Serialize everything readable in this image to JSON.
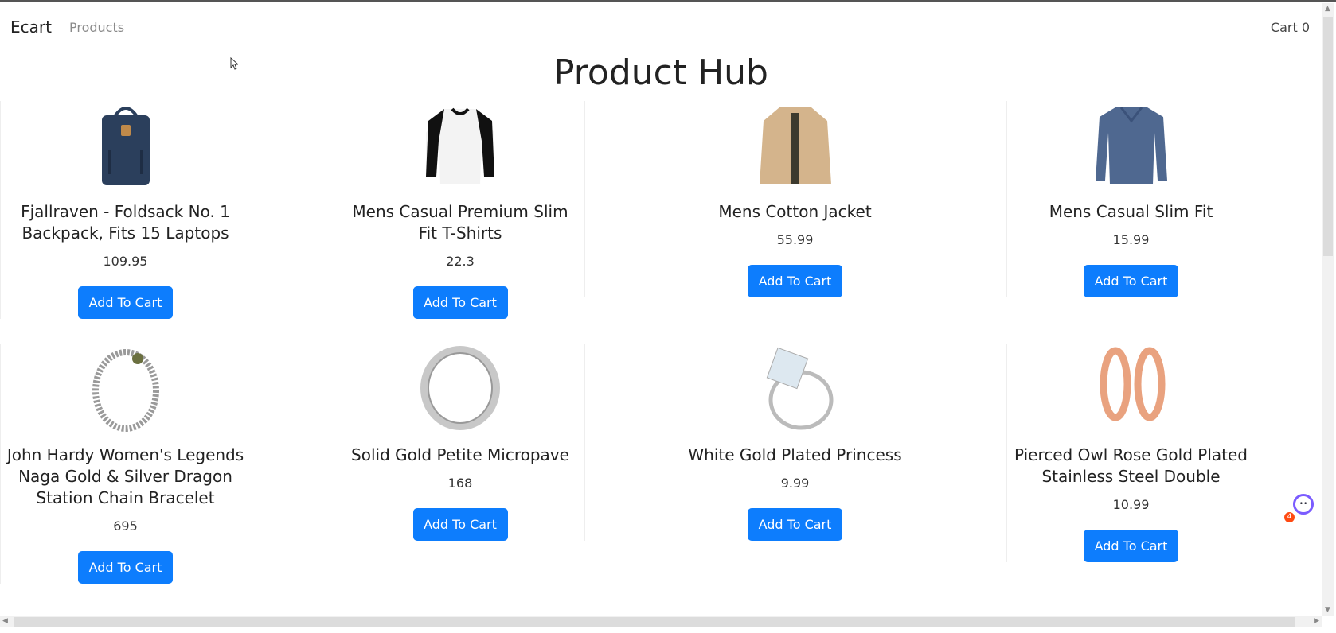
{
  "nav": {
    "brand": "Ecart",
    "products_link": "Products",
    "cart_label": "Cart 0"
  },
  "page_title": "Product Hub",
  "products": [
    {
      "name": "Fjallraven - Foldsack No. 1 Backpack, Fits 15 Laptops",
      "price": "109.95",
      "button": "Add To Cart",
      "icon": "backpack"
    },
    {
      "name": "Mens Casual Premium Slim Fit T-Shirts",
      "price": "22.3",
      "button": "Add To Cart",
      "icon": "tshirt"
    },
    {
      "name": "Mens Cotton Jacket",
      "price": "55.99",
      "button": "Add To Cart",
      "icon": "jacket"
    },
    {
      "name": "Mens Casual Slim Fit",
      "price": "15.99",
      "button": "Add To Cart",
      "icon": "longsleeve"
    },
    {
      "name": "John Hardy Women's Legends Naga Gold & Silver Dragon Station Chain Bracelet",
      "price": "695",
      "button": "Add To Cart",
      "icon": "bracelet"
    },
    {
      "name": "Solid Gold Petite Micropave",
      "price": "168",
      "button": "Add To Cart",
      "icon": "ring"
    },
    {
      "name": "White Gold Plated Princess",
      "price": "9.99",
      "button": "Add To Cart",
      "icon": "diamond-ring"
    },
    {
      "name": "Pierced Owl Rose Gold Plated Stainless Steel Double",
      "price": "10.99",
      "button": "Add To Cart",
      "icon": "earrings"
    }
  ],
  "widget": {
    "badge_count": "4"
  },
  "colors": {
    "accent": "#0d7dfd"
  }
}
